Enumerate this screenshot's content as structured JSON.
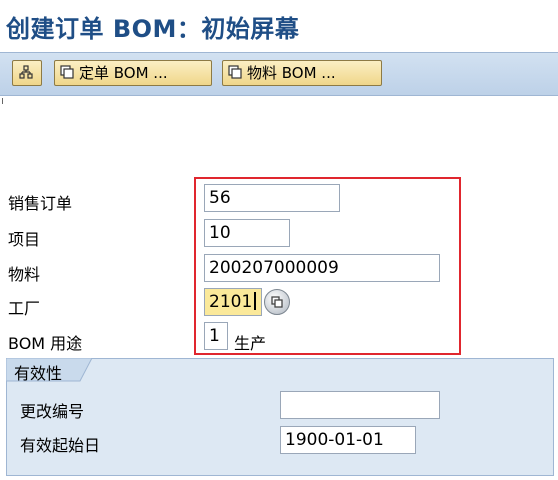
{
  "title": "创建订单 BOM：初始屏幕",
  "toolbar": {
    "variant_icon": "hierarchy-icon",
    "order_bom_label": "定单 BOM ...",
    "material_bom_label": "物料 BOM ..."
  },
  "fields": {
    "sales_order": {
      "label": "销售订单",
      "value": "56"
    },
    "item": {
      "label": "项目",
      "value": "10"
    },
    "material": {
      "label": "物料",
      "value": "200207000009"
    },
    "plant": {
      "label": "工厂",
      "value": "2101"
    },
    "bom_usage": {
      "label": "BOM 用途",
      "value": "1",
      "desc": "生产"
    }
  },
  "validity": {
    "tab_label": "有效性",
    "change_number": {
      "label": "更改编号",
      "value": ""
    },
    "valid_from": {
      "label": "有效起始日",
      "value": "1900-01-01"
    }
  },
  "colors": {
    "title": "#1f4e86",
    "highlight": "#e0262e",
    "focus_field": "#fbe99a",
    "group_bg": "#dde8f3"
  }
}
